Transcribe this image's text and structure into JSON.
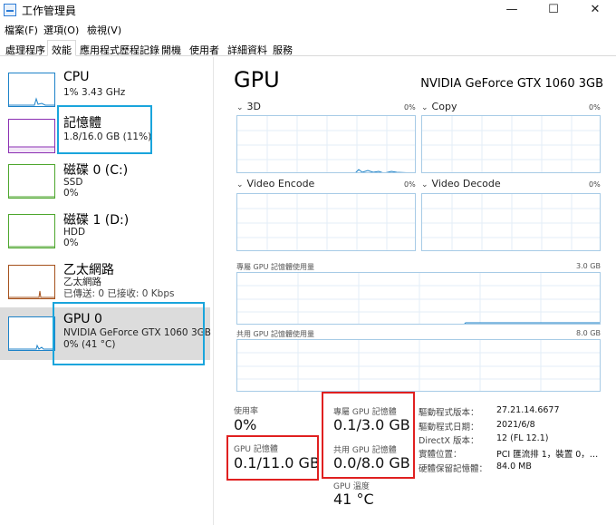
{
  "window": {
    "title": "工作管理員",
    "minimize": "—",
    "maximize": "☐",
    "close": "✕"
  },
  "menu": [
    "檔案(F)",
    "選項(O)",
    "檢視(V)"
  ],
  "tabs": [
    "處理程序",
    "效能",
    "應用程式歷程記錄",
    "開機",
    "使用者",
    "詳細資料",
    "服務"
  ],
  "sidebar": [
    {
      "title": "CPU",
      "sub1": "1% 3.43 GHz",
      "sub2": "",
      "color": "#1c82c8"
    },
    {
      "title": "記憶體",
      "sub1": "1.8/16.0 GB (11%)",
      "sub2": "",
      "color": "#8b2fb3"
    },
    {
      "title": "磁碟 0 (C:)",
      "sub1": "SSD",
      "sub2": "0%",
      "color": "#4ca62c"
    },
    {
      "title": "磁碟 1 (D:)",
      "sub1": "HDD",
      "sub2": "0%",
      "color": "#4ca62c"
    },
    {
      "title": "乙太網路",
      "sub1": "乙太網路",
      "sub2": "已傳送: 0 已接收: 0 Kbps",
      "color": "#a5501b"
    },
    {
      "title": "GPU 0",
      "sub1": "NVIDIA GeForce GTX 1060 3GB",
      "sub2": "0% (41 °C)",
      "color": "#1c82c8"
    }
  ],
  "main": {
    "title": "GPU",
    "model": "NVIDIA GeForce GTX 1060 3GB",
    "engines": [
      {
        "label": "3D",
        "pct": "0%"
      },
      {
        "label": "Copy",
        "pct": "0%"
      },
      {
        "label": "Video Encode",
        "pct": "0%"
      },
      {
        "label": "Video Decode",
        "pct": "0%"
      }
    ],
    "dedicated_label": "專屬 GPU 記憶體使用量",
    "dedicated_max": "3.0 GB",
    "shared_label": "共用 GPU 記憶體使用量",
    "shared_max": "8.0 GB",
    "stats": {
      "usage_label": "使用率",
      "usage_value": "0%",
      "gpu_mem_label": "GPU 記憶體",
      "gpu_mem_value": "0.1/11.0 GB",
      "dedicated_mem_label": "專屬 GPU 記憶體",
      "dedicated_mem_value": "0.1/3.0 GB",
      "shared_mem_label": "共用 GPU 記憶體",
      "shared_mem_value": "0.0/8.0 GB",
      "temp_label": "GPU 溫度",
      "temp_value": "41 °C"
    },
    "info": [
      {
        "label": "驅動程式版本：",
        "value": "27.21.14.6677"
      },
      {
        "label": "驅動程式日期：",
        "value": "2021/6/8"
      },
      {
        "label": "DirectX 版本：",
        "value": "12 (FL 12.1)"
      },
      {
        "label": "實體位置：",
        "value": "PCI 匯流排 1，裝置 0，…"
      },
      {
        "label": "硬體保留記憶體：",
        "value": "84.0 MB"
      }
    ]
  },
  "colors": {
    "highlight_blue": "#1aa5dc",
    "highlight_red": "#e02020",
    "graph_line": "#1c82c8",
    "graph_border": "#a7cbe6"
  }
}
